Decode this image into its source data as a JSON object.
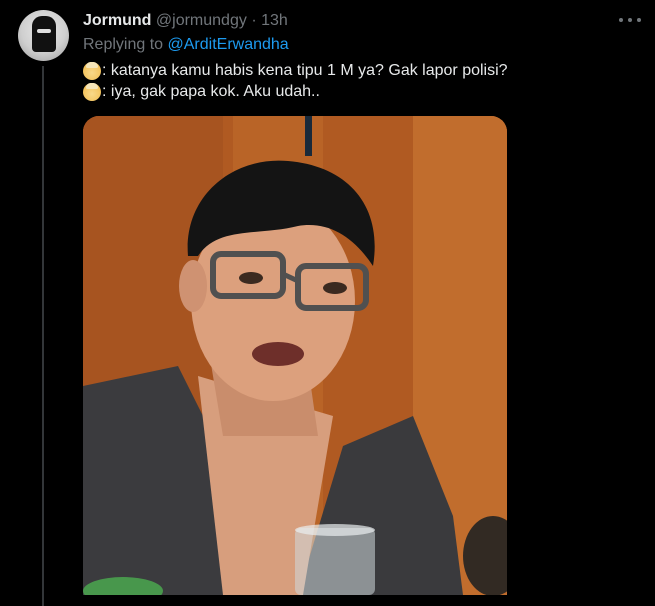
{
  "tweet": {
    "author_name": "Jormund",
    "author_handle": "@jormundgy",
    "separator": "·",
    "time": "13h",
    "replying_prefix": "Replying to ",
    "replying_to": "@ArditErwandha",
    "lines": [
      {
        "emoji": "older-person-emoji",
        "text": ": katanya kamu habis kena tipu 1 M ya? Gak lapor polisi?"
      },
      {
        "emoji": "older-person-emoji",
        "text": ": iya, gak papa kok. Aku udah.."
      }
    ]
  },
  "icons": {
    "more": "more-horizontal-icon"
  },
  "colors": {
    "background": "#000000",
    "text": "#e7e9ea",
    "muted": "#71767b",
    "link": "#1d9bf0"
  }
}
